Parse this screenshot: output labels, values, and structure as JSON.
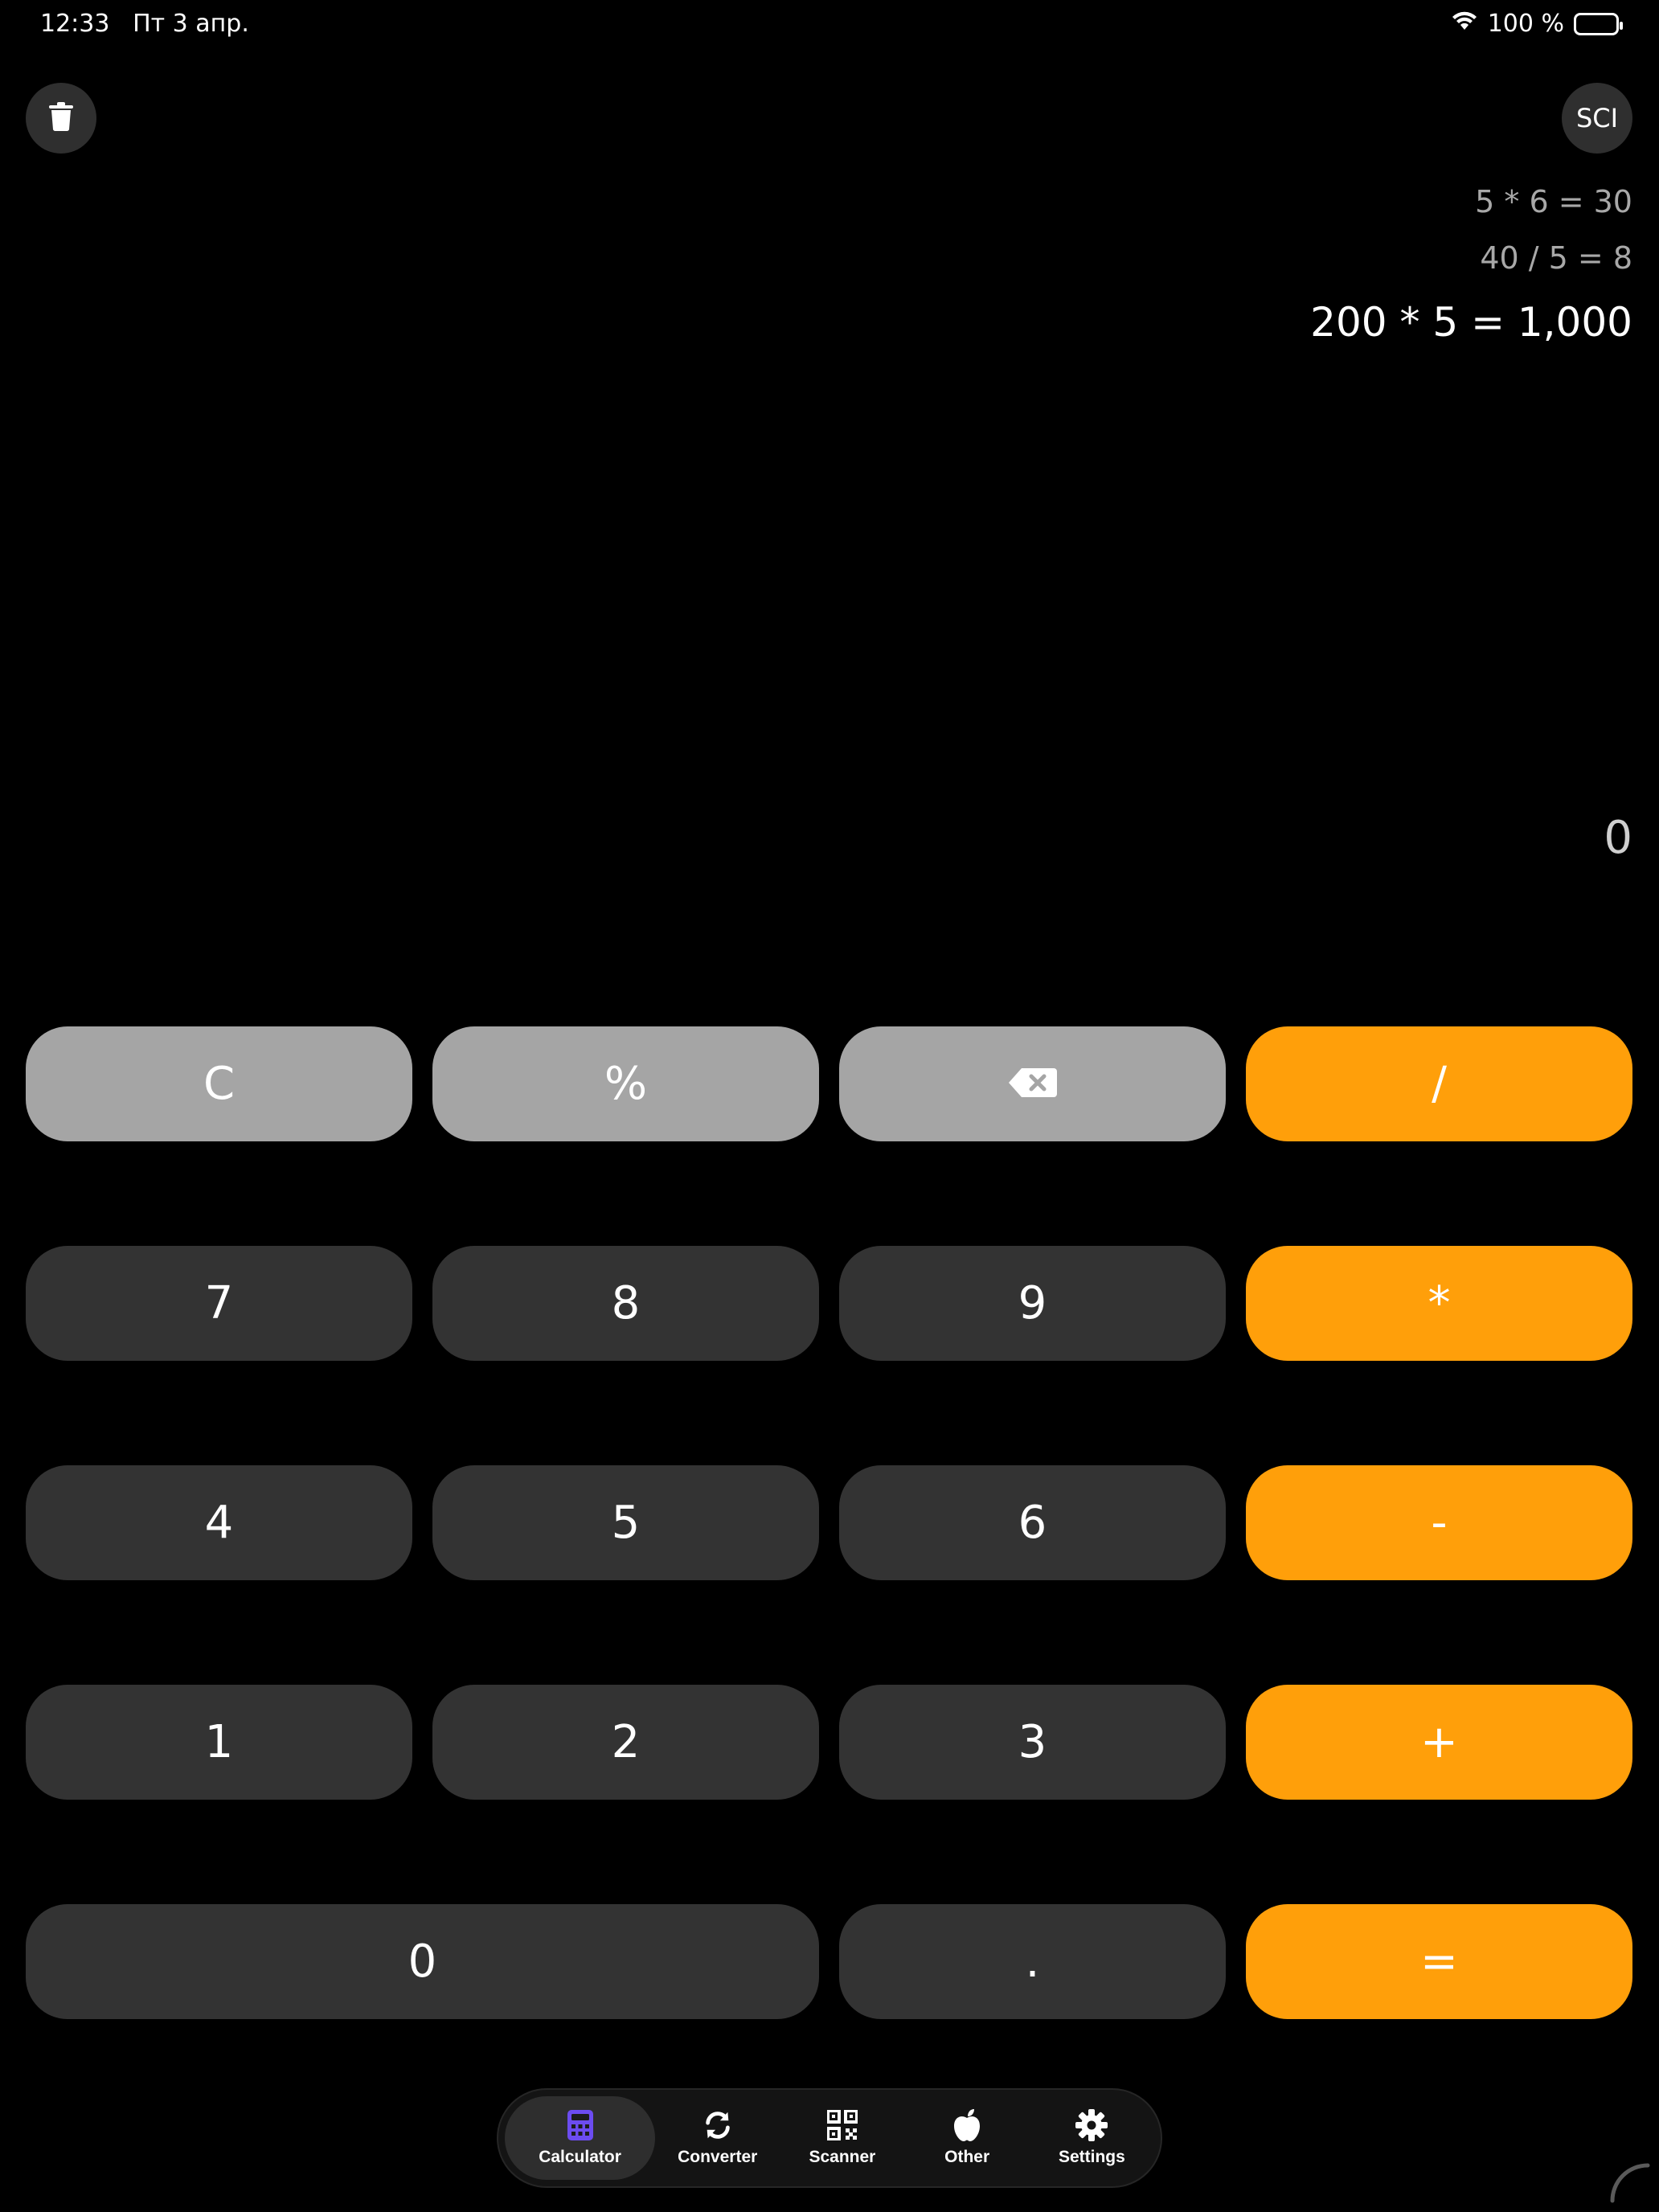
{
  "status_bar": {
    "time": "12:33",
    "date": "Пт 3 апр.",
    "battery": "100 %"
  },
  "top": {
    "sci_label": "SCI"
  },
  "history": [
    {
      "expression": "5 * 6 = 30"
    },
    {
      "expression": "40 / 5 = 8"
    },
    {
      "expression": "200 * 5 = 1,000"
    }
  ],
  "display": {
    "value": "0"
  },
  "keys": {
    "clear": "C",
    "percent": "%",
    "divide": "/",
    "seven": "7",
    "eight": "8",
    "nine": "9",
    "multiply": "*",
    "four": "4",
    "five": "5",
    "six": "6",
    "minus": "-",
    "one": "1",
    "two": "2",
    "three": "3",
    "plus": "+",
    "zero": "0",
    "decimal": ".",
    "equals": "="
  },
  "tabs": [
    {
      "label": "Calculator",
      "icon": "calculator-icon",
      "active": true
    },
    {
      "label": "Converter",
      "icon": "refresh-icon",
      "active": false
    },
    {
      "label": "Scanner",
      "icon": "qr-code-icon",
      "active": false
    },
    {
      "label": "Other",
      "icon": "apple-icon",
      "active": false
    },
    {
      "label": "Settings",
      "icon": "gear-icon",
      "active": false
    }
  ],
  "colors": {
    "background": "#000000",
    "function_key": "#a5a5a5",
    "number_key": "#333333",
    "operator_key": "#ff9f0a",
    "active_tab_icon": "#6c4cf0"
  }
}
